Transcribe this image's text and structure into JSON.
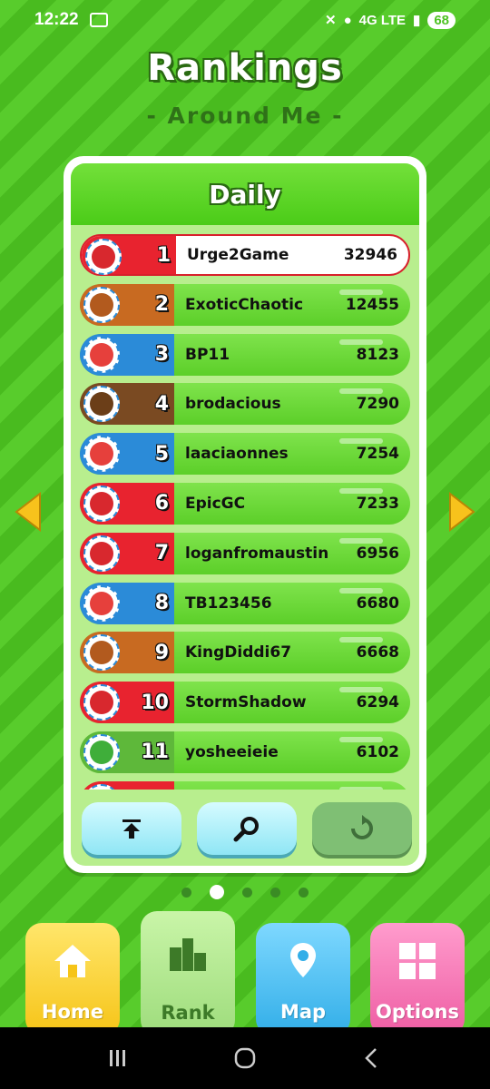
{
  "status": {
    "time": "12:22",
    "network": "4G LTE",
    "battery": "68"
  },
  "title": "Rankings",
  "subtitle": "- Around Me -",
  "panel": {
    "tab": "Daily"
  },
  "entries": [
    {
      "rank": "1",
      "name": "Urge2Game",
      "score": "32946",
      "color": "#e8232f",
      "avatar": "#d8282e",
      "self": true
    },
    {
      "rank": "2",
      "name": "ExoticChaotic",
      "score": "12455",
      "color": "#c86a21",
      "avatar": "#b25a1e"
    },
    {
      "rank": "3",
      "name": "BP11",
      "score": "8123",
      "color": "#2b8bd8",
      "avatar": "#e6403c"
    },
    {
      "rank": "4",
      "name": "brodacious",
      "score": "7290",
      "color": "#7a4a22",
      "avatar": "#6b3e18"
    },
    {
      "rank": "5",
      "name": "laaciaonnes",
      "score": "7254",
      "color": "#2b8bd8",
      "avatar": "#e6403c"
    },
    {
      "rank": "6",
      "name": "EpicGC",
      "score": "7233",
      "color": "#e8232f",
      "avatar": "#d8282e"
    },
    {
      "rank": "7",
      "name": "loganfromaustin",
      "score": "6956",
      "color": "#e8232f",
      "avatar": "#d8282e"
    },
    {
      "rank": "8",
      "name": "TB123456",
      "score": "6680",
      "color": "#2b8bd8",
      "avatar": "#e6403c"
    },
    {
      "rank": "9",
      "name": "KingDiddi67",
      "score": "6668",
      "color": "#c86a21",
      "avatar": "#b25a1e"
    },
    {
      "rank": "10",
      "name": "StormShadow",
      "score": "6294",
      "color": "#e8232f",
      "avatar": "#d8282e"
    },
    {
      "rank": "11",
      "name": "yosheeieie",
      "score": "6102",
      "color": "#5eb83a",
      "avatar": "#3fae3a"
    },
    {
      "rank": "",
      "name": "",
      "score": "",
      "color": "#e8232f",
      "avatar": "#d8282e"
    }
  ],
  "buttons": {
    "top": "scroll-to-top",
    "search": "search",
    "refresh": "refresh"
  },
  "nav": {
    "home": "Home",
    "rank": "Rank",
    "map": "Map",
    "options": "Options"
  },
  "pager": {
    "count": 5,
    "active": 1
  }
}
